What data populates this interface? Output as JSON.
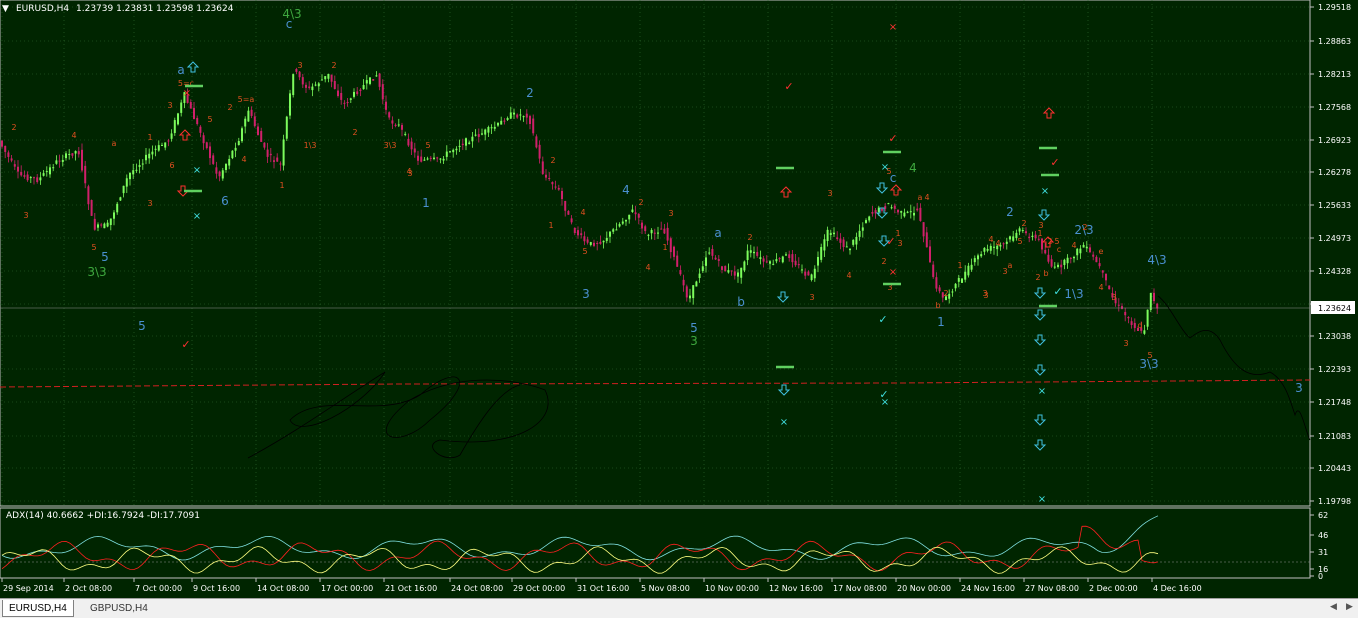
{
  "main_chart": {
    "symbol_timeframe": "EURUSD,H4",
    "ohlc": "1.23739 1.23831 1.23598 1.23624",
    "current_price": "1.23624",
    "price_ticks": [
      "1.29518",
      "1.28863",
      "1.28213",
      "1.27568",
      "1.26923",
      "1.26278",
      "1.25633",
      "1.24973",
      "1.24328",
      "1.23683",
      "1.23038",
      "1.22393",
      "1.21748",
      "1.21083",
      "1.20443",
      "1.19798"
    ],
    "colors": {
      "background": "#002500",
      "bull": "#7cfc5c",
      "bear": "#d0206a",
      "grid": "#2f6b2f",
      "dashed": "#d02020",
      "price_box": "#ffffff"
    }
  },
  "wave_labels": [
    {
      "t": "4\\3",
      "c": "green"
    },
    {
      "t": "c",
      "c": "blue"
    },
    {
      "t": "5",
      "c": "blue"
    },
    {
      "t": "3\\3",
      "c": "green"
    },
    {
      "t": "6",
      "c": "blue"
    },
    {
      "t": "1",
      "c": "blue"
    },
    {
      "t": "2",
      "c": "blue"
    },
    {
      "t": "4",
      "c": "blue"
    },
    {
      "t": "3",
      "c": "blue"
    },
    {
      "t": "5",
      "c": "blue"
    },
    {
      "t": "3",
      "c": "green"
    },
    {
      "t": "a",
      "c": "blue"
    },
    {
      "t": "b",
      "c": "blue"
    },
    {
      "t": "c",
      "c": "blue"
    },
    {
      "t": "4",
      "c": "green"
    },
    {
      "t": "1",
      "c": "blue"
    },
    {
      "t": "2",
      "c": "blue"
    },
    {
      "t": "1\\3",
      "c": "blue"
    },
    {
      "t": "2\\3",
      "c": "blue"
    },
    {
      "t": "4\\3",
      "c": "blue"
    },
    {
      "t": "3\\3",
      "c": "blue"
    },
    {
      "t": "3",
      "c": "blue"
    },
    {
      "t": "a",
      "c": "blue"
    },
    {
      "t": "5",
      "c": "blue"
    }
  ],
  "small_labels": [
    "2",
    "3",
    "4",
    "a",
    "5",
    "1",
    "5=c",
    "3",
    "5",
    "6",
    "3",
    "5=a",
    "2",
    "4",
    "1",
    "1\\3",
    "2",
    "3\\3",
    "3",
    "5",
    "4",
    "2",
    "3",
    "1",
    "2",
    "4",
    "5",
    "2",
    "4",
    "3",
    "1",
    "2",
    "3",
    "3",
    "4",
    "5",
    "3",
    "a",
    "4",
    "2",
    "b",
    "1",
    "3",
    "4",
    "3",
    "2",
    "1",
    "2",
    "5",
    "e",
    "4",
    "3",
    "d",
    "5",
    "2",
    "4",
    "3",
    "3",
    "4",
    "5",
    "3",
    "2",
    "b",
    "c",
    "a",
    "1",
    "2",
    "3"
  ],
  "indicator": {
    "title": "ADX(14) 40.6662 +DI:16.7924 -DI:17.7091",
    "ticks": [
      "62",
      "46",
      "31",
      "16",
      "0"
    ],
    "colors": {
      "adx": "#7fe0e0",
      "plus_di": "#ffff80",
      "minus_di": "#ff2020"
    }
  },
  "time_axis": [
    "29 Sep 2014",
    "2 Oct 08:00",
    "7 Oct 00:00",
    "9 Oct 16:00",
    "14 Oct 08:00",
    "17 Oct 00:00",
    "21 Oct 16:00",
    "24 Oct 08:00",
    "29 Oct 00:00",
    "31 Oct 16:00",
    "5 Nov 08:00",
    "10 Nov 00:00",
    "12 Nov 16:00",
    "17 Nov 08:00",
    "20 Nov 00:00",
    "24 Nov 16:00",
    "27 Nov 08:00",
    "2 Dec 00:00",
    "4 Dec 16:00"
  ],
  "tabs": [
    "EURUSD,H4",
    "GBPUSD,H4"
  ]
}
